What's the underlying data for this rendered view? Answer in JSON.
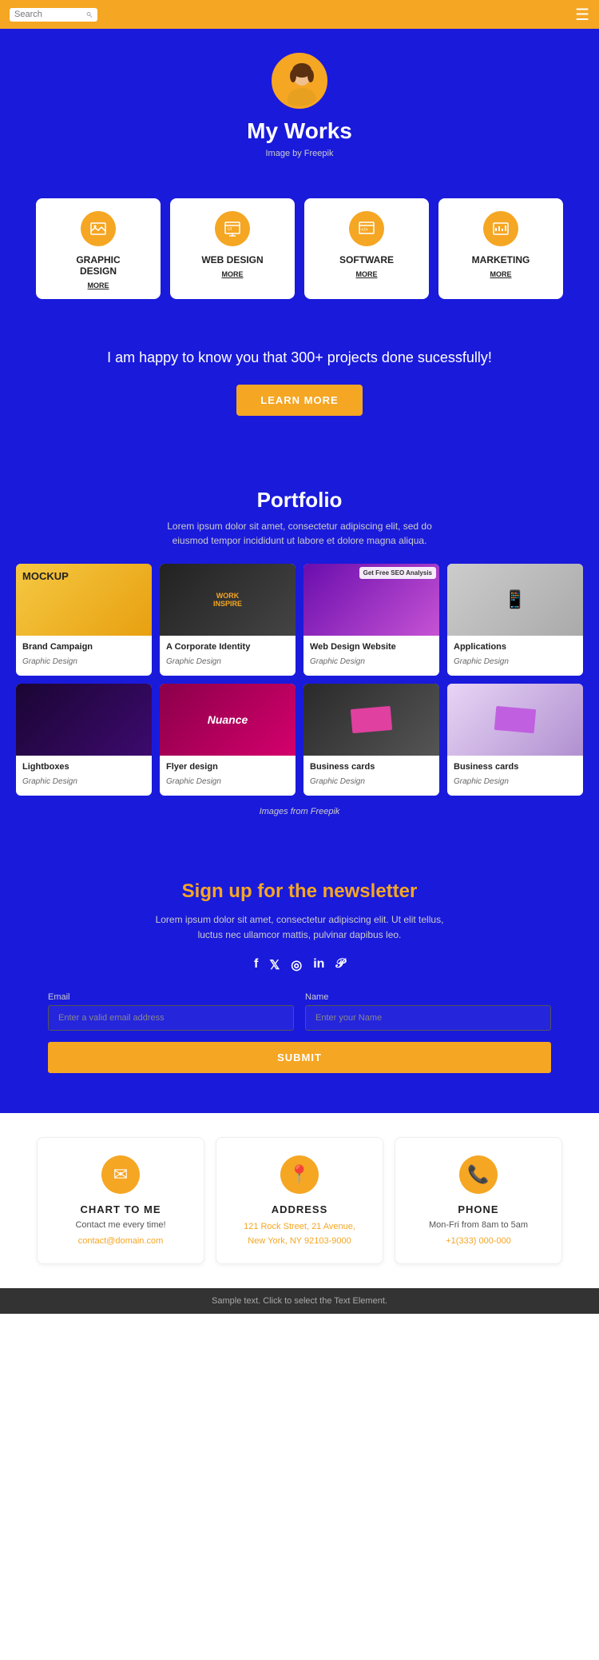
{
  "navbar": {
    "search_placeholder": "Search",
    "search_icon": "search-icon"
  },
  "hero": {
    "title": "My Works",
    "subtitle": "Image by Freepik"
  },
  "services": [
    {
      "id": "graphic-design",
      "title": "GRAPHIC\nDESIGN",
      "icon": "🖼",
      "more": "MORE"
    },
    {
      "id": "web-design",
      "title": "WEB DESIGN",
      "icon": "🖥",
      "more": "MORE"
    },
    {
      "id": "software",
      "title": "SOFTWARE",
      "icon": "💻",
      "more": "MORE"
    },
    {
      "id": "marketing",
      "title": "MARKETING",
      "icon": "📊",
      "more": "MORE"
    }
  ],
  "promo": {
    "text": "I am happy to know you that 300+ projects done sucessfully!",
    "button": "LEARN MORE"
  },
  "portfolio": {
    "title": "Portfolio",
    "description": "Lorem ipsum dolor sit amet, consectetur adipiscing elit, sed do eiusmod tempor incididunt ut labore et dolore magna aliqua.",
    "items": [
      {
        "name": "Brand Campaign",
        "category": "Graphic Design",
        "color": "img-yellow"
      },
      {
        "name": "A Corporate Identity",
        "category": "Graphic Design",
        "color": "img-dark"
      },
      {
        "name": "Web Design Website",
        "category": "Graphic Design",
        "color": "img-purple"
      },
      {
        "name": "Applications",
        "category": "Graphic Design",
        "color": "img-phone"
      },
      {
        "name": "Lightboxes",
        "category": "Graphic Design",
        "color": "img-dark2"
      },
      {
        "name": "Flyer design",
        "category": "Graphic Design",
        "color": "img-dance"
      },
      {
        "name": "Business cards",
        "category": "Graphic Design",
        "color": "img-cards"
      },
      {
        "name": "Business cards",
        "category": "Graphic Design",
        "color": "img-biz"
      }
    ],
    "note": "Images from Freepik"
  },
  "newsletter": {
    "title": "Sign up for the newsletter",
    "description": "Lorem ipsum dolor sit amet, consectetur adipiscing elit. Ut elit tellus, luctus nec ullamcor mattis, pulvinar dapibus leo.",
    "social": [
      "f",
      "𝕏",
      "in",
      "in",
      "𝒫"
    ],
    "email_label": "Email",
    "email_placeholder": "Enter a valid email address",
    "name_label": "Name",
    "name_placeholder": "Enter your Name",
    "submit_button": "SUBMIT"
  },
  "contact": [
    {
      "icon": "✉",
      "title": "CHART TO ME",
      "subtitle": "Contact me every time!",
      "link": "contact@domain.com"
    },
    {
      "icon": "📍",
      "title": "ADDRESS",
      "address_line1": "121 Rock Street, 21 Avenue,",
      "address_line2": "New York, NY 92103-9000"
    },
    {
      "icon": "📞",
      "title": "PHONE",
      "hours": "Mon-Fri from 8am to 5am",
      "phone": "+1(333) 000-000"
    }
  ],
  "footer": {
    "text": "Sample text. Click to select the Text Element."
  }
}
